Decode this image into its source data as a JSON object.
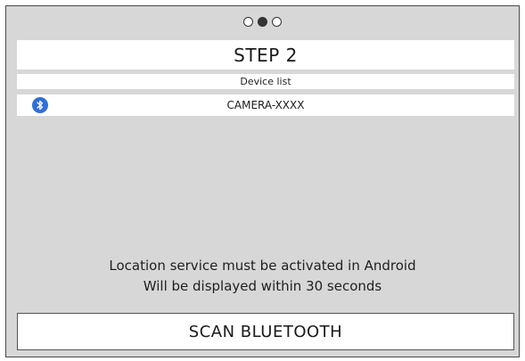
{
  "pager": {
    "total": 3,
    "active_index": 1
  },
  "step": {
    "title": "STEP 2"
  },
  "device_list": {
    "header": "Device list",
    "items": [
      {
        "name": "CAMERA-XXXX",
        "icon": "bluetooth-icon"
      }
    ]
  },
  "info": {
    "line1": "Location service must be activated in Android",
    "line2": "Will be displayed within 30 seconds"
  },
  "actions": {
    "scan_label": "SCAN BLUETOOTH"
  },
  "colors": {
    "background": "#d7d7d7",
    "panel": "#ffffff",
    "bluetooth": "#2f6fd6",
    "text": "#1a1a1a"
  }
}
